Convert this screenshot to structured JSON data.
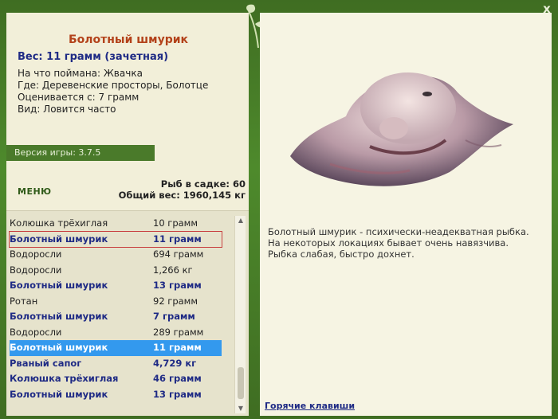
{
  "window": {
    "close_label": "x"
  },
  "fish": {
    "name": "Болотный шмурик",
    "weight_line": "Вес: 11 грамм (зачетная)",
    "caught_on": "На что поймана: Жвачка",
    "where": "Где: Деревенские просторы, Болотце",
    "value": "Оценивается с: 7 грамм",
    "kind": "Вид: Ловится часто",
    "description": [
      "Болотный шмурик - психически-неадекватная рыбка.",
      "На некоторых локациях бывает очень навязчива.",
      "Рыбка слабая, быстро дохнет."
    ]
  },
  "version": "Версия игры: 3.7.5",
  "menu_label": "МЕНЮ",
  "stats": {
    "fish_count": "Рыб в садке: 60",
    "total_weight": "Общий вес: 1960,145 кг"
  },
  "catch_list": [
    {
      "name": "Колюшка трёхиглая",
      "weight": "10 грамм",
      "style": "plain"
    },
    {
      "name": "Болотный шмурик",
      "weight": "11 грамм",
      "style": "bold outlined"
    },
    {
      "name": "Водоросли",
      "weight": "694 грамм",
      "style": "plain"
    },
    {
      "name": "Водоросли",
      "weight": "1,266 кг",
      "style": "plain"
    },
    {
      "name": "Болотный шмурик",
      "weight": "13 грамм",
      "style": "bold"
    },
    {
      "name": "Ротан",
      "weight": "92 грамм",
      "style": "plain"
    },
    {
      "name": "Болотный шмурик",
      "weight": "7 грамм",
      "style": "bold"
    },
    {
      "name": "Водоросли",
      "weight": "289 грамм",
      "style": "plain"
    },
    {
      "name": "Болотный шмурик",
      "weight": "11 грамм",
      "style": "bold selected"
    },
    {
      "name": "Рваный сапог",
      "weight": "4,729 кг",
      "style": "bold"
    },
    {
      "name": "Колюшка трёхиглая",
      "weight": "46 грамм",
      "style": "bold"
    },
    {
      "name": "Болотный шмурик",
      "weight": "13 грамм",
      "style": "bold"
    }
  ],
  "hotkeys_label": "Горячие клавиши",
  "colors": {
    "frame_green": "#4a7a2a",
    "fish_name": "#b3421a",
    "bold_text": "#1f2b85",
    "selected_row": "#3399ee",
    "outline": "#c84040"
  }
}
